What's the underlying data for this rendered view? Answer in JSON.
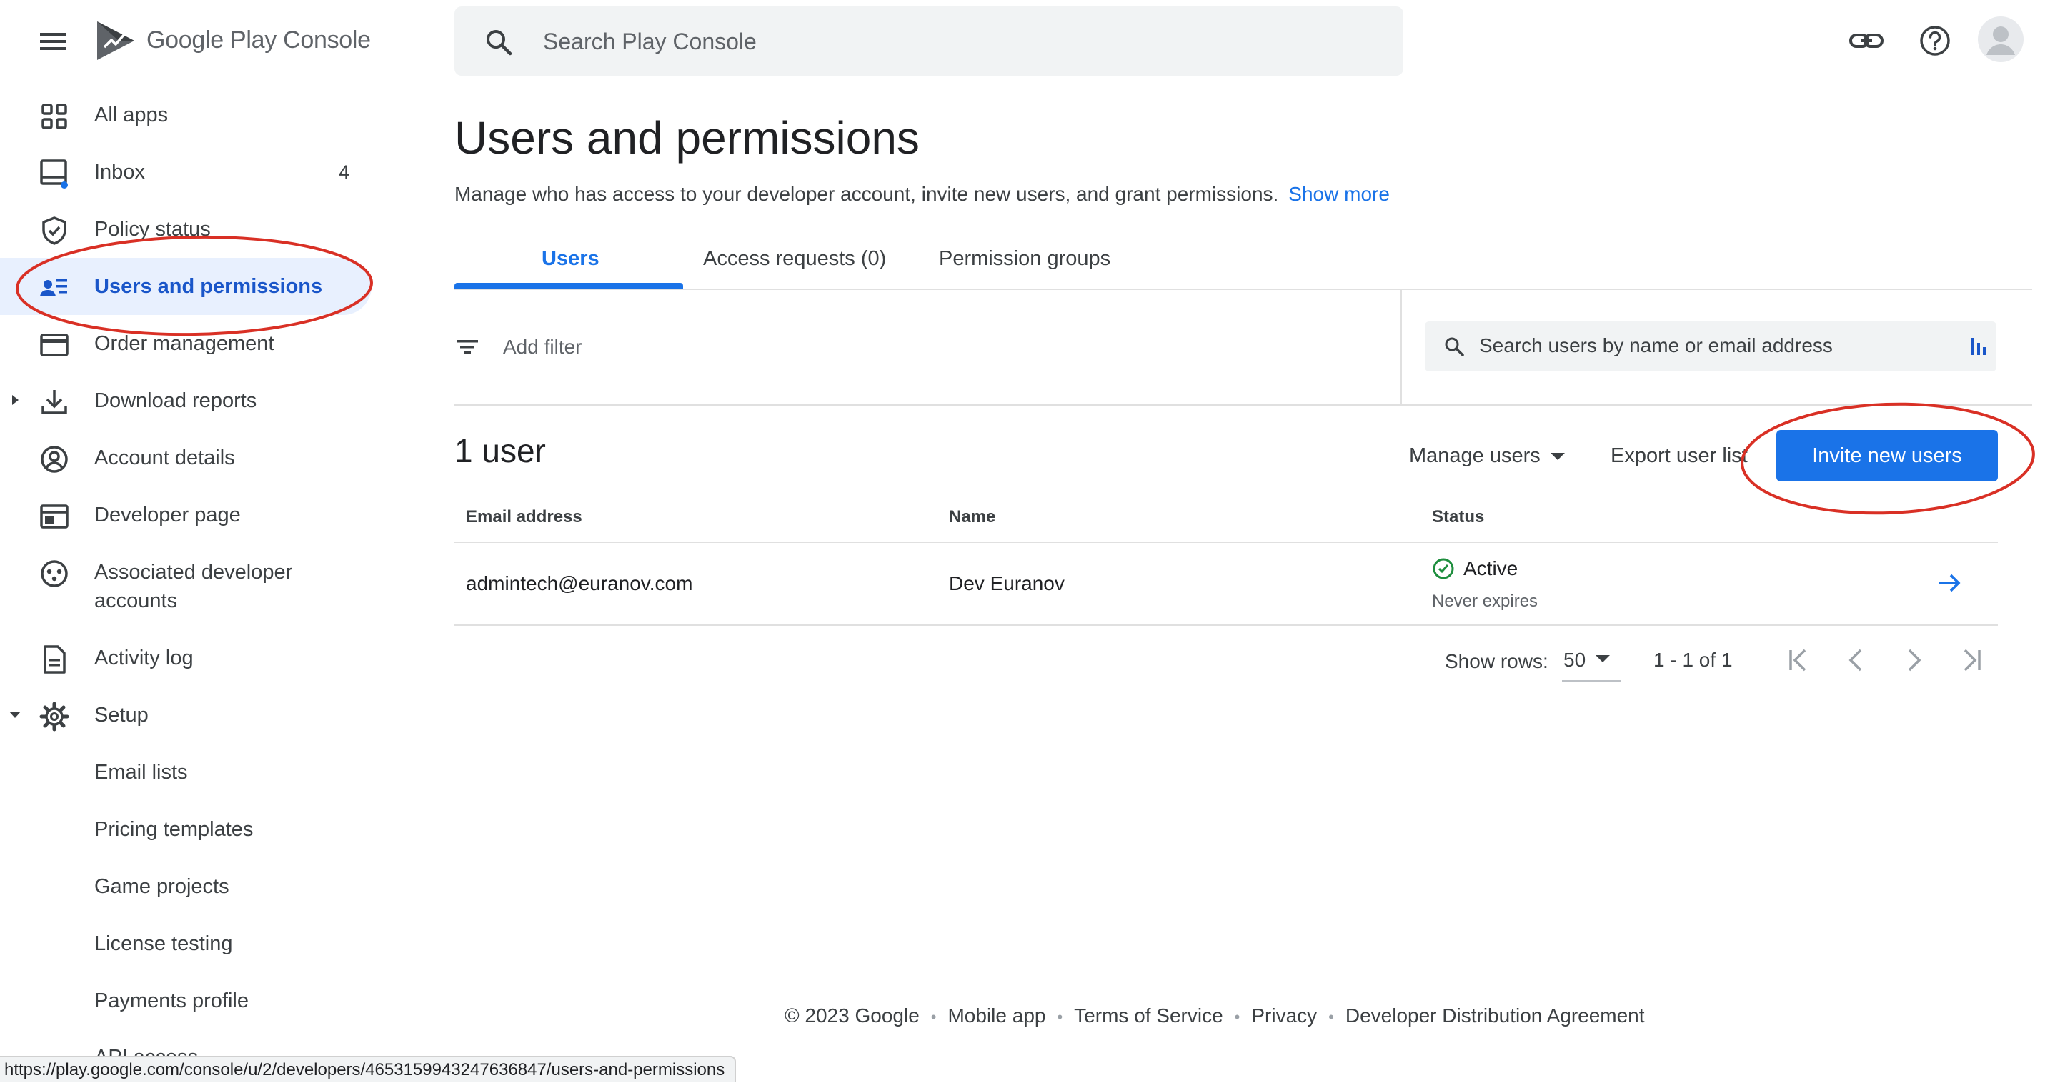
{
  "app": {
    "brand_google": "Google",
    "brand_play": "Play",
    "brand_console": "Console",
    "search_placeholder": "Search Play Console"
  },
  "sidebar": {
    "items": [
      {
        "label": "All apps",
        "icon": "apps-grid-icon"
      },
      {
        "label": "Inbox",
        "icon": "inbox-icon",
        "count": "4"
      },
      {
        "label": "Policy status",
        "icon": "shield-check-icon"
      },
      {
        "label": "Users and permissions",
        "icon": "people-list-icon",
        "active": true
      },
      {
        "label": "Order management",
        "icon": "credit-card-icon"
      },
      {
        "label": "Download reports",
        "icon": "download-icon"
      },
      {
        "label": "Account details",
        "icon": "account-circle-icon"
      },
      {
        "label": "Developer page",
        "icon": "web-page-icon"
      },
      {
        "label": "Associated developer accounts",
        "line1": "Associated developer",
        "line2": "accounts",
        "icon": "associated-accounts-icon"
      },
      {
        "label": "Activity log",
        "icon": "document-icon"
      },
      {
        "label": "Setup",
        "icon": "gear-icon"
      }
    ],
    "setup_items": [
      "Email lists",
      "Pricing templates",
      "Game projects",
      "License testing",
      "Payments profile",
      "API access"
    ]
  },
  "main": {
    "title": "Users and permissions",
    "description": "Manage who has access to your developer account, invite new users, and grant permissions.",
    "show_more": "Show more",
    "tabs": [
      "Users",
      "Access requests (0)",
      "Permission groups"
    ],
    "add_filter": "Add filter",
    "user_search_placeholder": "Search users by name or email address",
    "user_count": "1 user",
    "manage_users": "Manage users",
    "export_user_list": "Export user list",
    "invite_button": "Invite new users",
    "table": {
      "columns": [
        "Email address",
        "Name",
        "Status"
      ],
      "rows": [
        {
          "email": "admintech@euranov.com",
          "name": "Dev Euranov",
          "status": "Active",
          "expires": "Never expires"
        }
      ]
    },
    "pagination": {
      "show_rows_label": "Show rows:",
      "rows_value": "50",
      "range": "1 - 1 of 1"
    }
  },
  "footer": {
    "copyright": "© 2023 Google",
    "links": [
      "Mobile app",
      "Terms of Service",
      "Privacy",
      "Developer Distribution Agreement"
    ]
  },
  "status_bar_url": "https://play.google.com/console/u/2/developers/4653159943247636847/users-and-permissions",
  "colors": {
    "accent": "#1a73e8",
    "active_nav_bg": "#e8f0fe",
    "status_active": "#1e8e3e",
    "annotation": "#d93025"
  }
}
